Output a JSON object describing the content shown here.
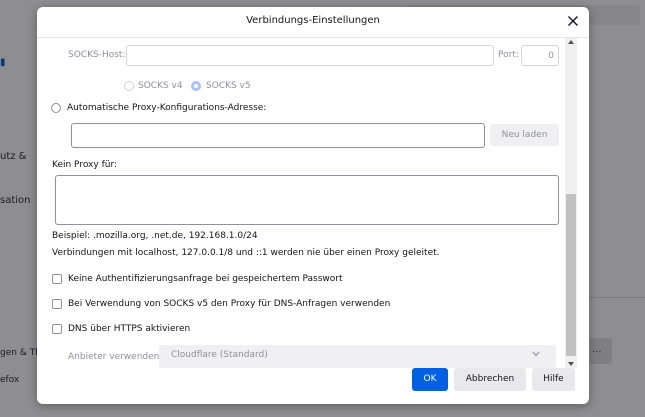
{
  "background": {
    "fragments": [
      "utz &",
      "sation",
      "gen & Th",
      "efox"
    ],
    "side_button_label": "..."
  },
  "dialog": {
    "title": "Verbindungs-Einstellungen",
    "socks_host_label": "SOCKS-Host:",
    "socks_host_value": "",
    "port_label": "Port:",
    "port_value": "0",
    "socks_v4_label": "SOCKS v4",
    "socks_v5_label": "SOCKS v5",
    "auto_proxy_label": "Automatische Proxy-Konfigurations-Adresse:",
    "auto_proxy_value": "",
    "reload_button": "Neu laden",
    "no_proxy_label": "Kein Proxy für:",
    "no_proxy_value": "",
    "example_text": "Beispiel: .mozilla.org, .net.de, 192.168.1.0/24",
    "localhost_text": "Verbindungen mit localhost, 127.0.0.1/8 und ::1 werden nie über einen Proxy geleitet.",
    "checkbox_auth": "Keine Authentifizierungsanfrage bei gespeichertem Passwort",
    "checkbox_socks_dns": "Bei Verwendung von SOCKS v5 den Proxy für DNS-Anfragen verwenden",
    "checkbox_doh": "DNS über HTTPS aktivieren",
    "provider_label": "Anbieter verwenden",
    "provider_value": "Cloudflare (Standard)",
    "ok_button": "OK",
    "cancel_button": "Abbrechen",
    "help_button": "Hilfe"
  },
  "colors": {
    "primary": "#0061e0",
    "disabled_text": "#8f8f9d",
    "overlay": "#8e8e90"
  },
  "icons": [
    "close-icon",
    "chevron-down-icon",
    "scroll-up-icon",
    "scroll-down-icon"
  ]
}
